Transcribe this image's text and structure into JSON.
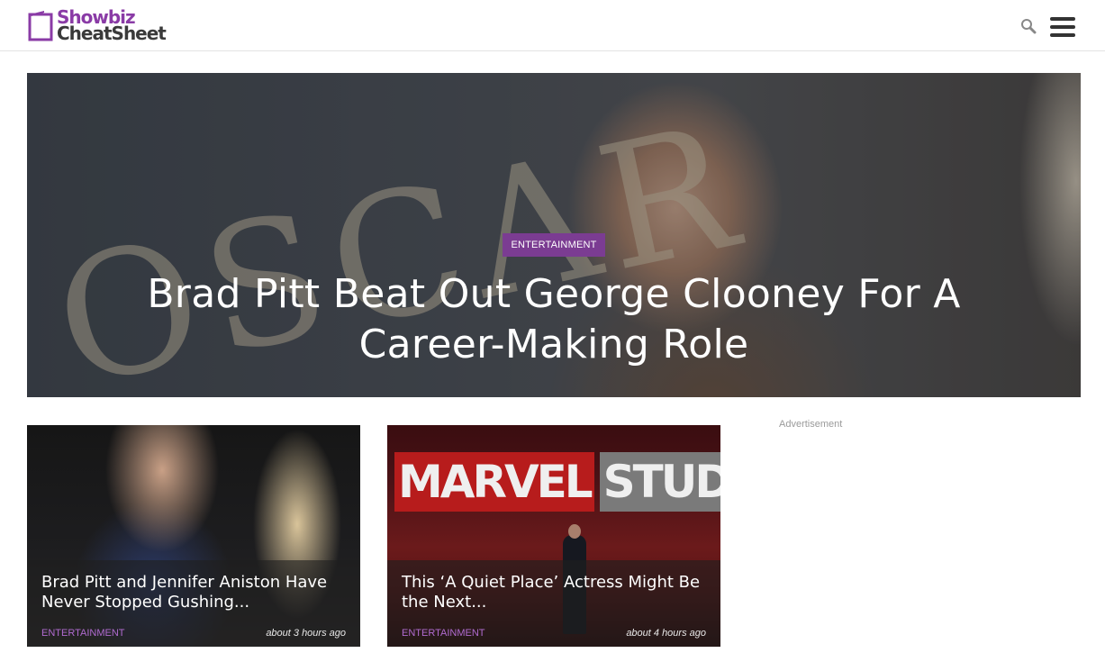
{
  "header": {
    "logo_line1": "Showbiz",
    "logo_line2": "CheatSheet",
    "search_icon": "search-icon",
    "menu_icon": "hamburger-menu-icon"
  },
  "hero": {
    "category": "ENTERTAINMENT",
    "title": "Brad Pitt Beat Out George Clooney For A Career-Making Role"
  },
  "cards": [
    {
      "title": "Brad Pitt and Jennifer Aniston Have Never Stopped Gushing...",
      "category": "ENTERTAINMENT",
      "time": "about 3 hours ago"
    },
    {
      "title": "This ‘A Quiet Place’ Actress Might Be the Next...",
      "category": "ENTERTAINMENT",
      "time": "about 4 hours ago"
    }
  ],
  "sidebar": {
    "ad_label": "Advertisement"
  },
  "colors": {
    "brand_purple": "#7b3c92",
    "tag_purple": "#b06bd0",
    "logo_dark": "#3a3a3a"
  }
}
